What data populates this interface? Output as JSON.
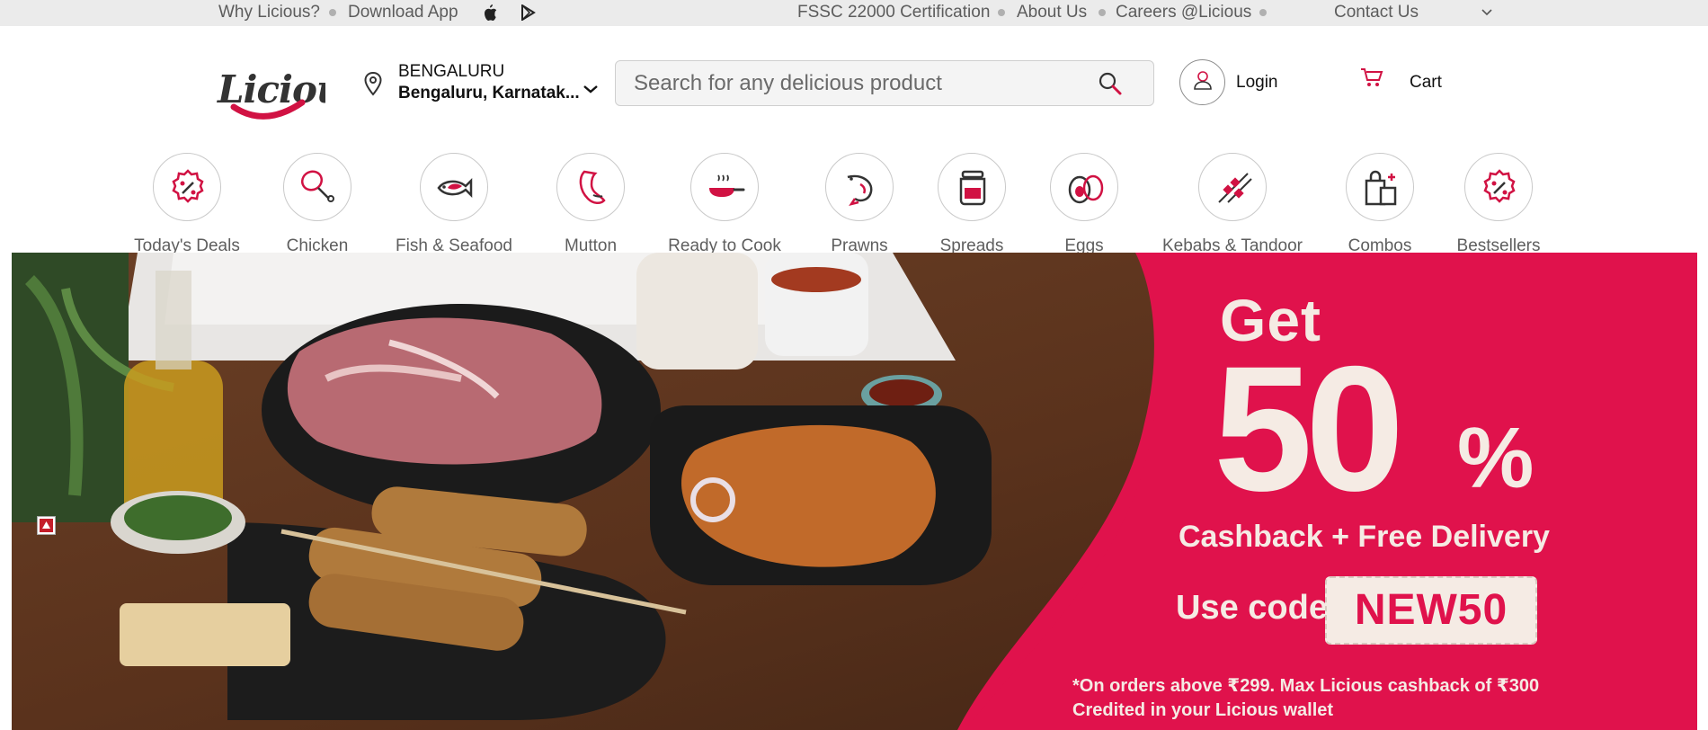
{
  "topbar": {
    "why": "Why Licious?",
    "download": "Download App",
    "fssc": "FSSC 22000 Certification",
    "about": "About Us",
    "careers": "Careers @Licious",
    "contact": "Contact Us",
    "apple_icon": "apple-icon",
    "playstore_icon": "play-store-icon"
  },
  "brand": {
    "name": "Licious",
    "color": "#d11243"
  },
  "location": {
    "city": "BENGALURU",
    "area": "Bengaluru, Karnatak..."
  },
  "search": {
    "placeholder": "Search for any delicious product"
  },
  "account": {
    "login": "Login",
    "cart": "Cart"
  },
  "categories": [
    {
      "label": "Today's Deals",
      "icon": "deals-icon"
    },
    {
      "label": "Chicken",
      "icon": "chicken-icon"
    },
    {
      "label": "Fish & Seafood",
      "icon": "fish-icon"
    },
    {
      "label": "Mutton",
      "icon": "mutton-icon"
    },
    {
      "label": "Ready to Cook",
      "icon": "pan-icon"
    },
    {
      "label": "Prawns",
      "icon": "prawn-icon"
    },
    {
      "label": "Spreads",
      "icon": "jar-icon"
    },
    {
      "label": "Eggs",
      "icon": "egg-icon"
    },
    {
      "label": "Kebabs & Tandoor",
      "icon": "kebab-icon"
    },
    {
      "label": "Combos",
      "icon": "combo-icon"
    },
    {
      "label": "Bestsellers",
      "icon": "bestseller-icon"
    }
  ],
  "banner": {
    "get": "Get",
    "percent_num": "50",
    "percent_sign": "%",
    "subtitle": "Cashback + Free Delivery",
    "use_code": "Use code",
    "code": "NEW50",
    "note_line1": "*On orders above ₹299. Max Licious cashback of ₹300",
    "note_line2": "Credited in your Licious wallet",
    "promo_color": "#e0124c"
  }
}
